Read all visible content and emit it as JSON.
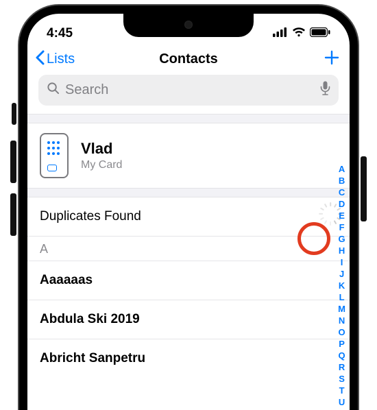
{
  "status": {
    "time": "4:45"
  },
  "nav": {
    "back": "Lists",
    "title": "Contacts"
  },
  "search": {
    "placeholder": "Search"
  },
  "myCard": {
    "name": "Vlad",
    "subtitle": "My Card"
  },
  "duplicates": {
    "label": "Duplicates Found"
  },
  "sections": {
    "A": {
      "header": "A",
      "items": [
        "Aaaaaas",
        "Abdula Ski 2019",
        "Abricht Sanpetru"
      ]
    }
  },
  "indexRail": [
    "A",
    "B",
    "C",
    "D",
    "E",
    "F",
    "G",
    "H",
    "I",
    "J",
    "K",
    "L",
    "M",
    "N",
    "O",
    "P",
    "Q",
    "R",
    "S",
    "T",
    "U"
  ],
  "colors": {
    "accent": "#007aff",
    "highlight": "#e23b1f"
  }
}
